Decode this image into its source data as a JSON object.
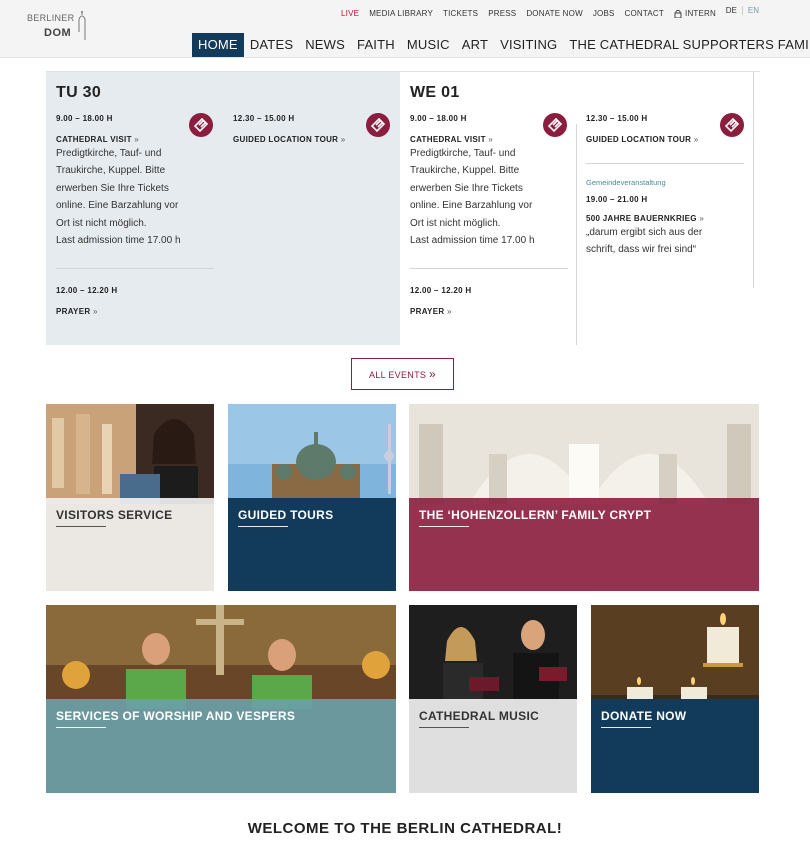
{
  "header": {
    "logo": {
      "line1": "BERLINER",
      "line2": "DOM"
    },
    "top_links": [
      "LIVE",
      "MEDIA LIBRARY",
      "TICKETS",
      "PRESS",
      "DONATE NOW",
      "JOBS",
      "CONTACT"
    ],
    "intern": "INTERN",
    "languages": {
      "de": "DE",
      "en": "EN"
    },
    "main_nav": [
      "HOME",
      "DATES",
      "NEWS",
      "FAITH",
      "MUSIC",
      "ART",
      "VISITING",
      "THE CATHEDRAL SUPPORTERS FAMILY"
    ],
    "active_nav": "HOME"
  },
  "events": {
    "day1": {
      "label": "TU 30",
      "col1": {
        "event1": {
          "time": "9.00 – 18.00 H",
          "title": "CATHEDRAL VISIT",
          "desc": [
            "Predigtkirche, Tauf- und",
            "Traukirche, Kuppel. Bitte",
            "erwerben Sie Ihre Tickets",
            "online. Eine Barzahlung vor",
            "Ort ist nicht möglich.",
            "Last admission time 17.00 h"
          ]
        },
        "event2": {
          "time": "12.00 – 12.20 H",
          "title": "PRAYER"
        }
      },
      "col2": {
        "event1": {
          "time": "12.30 – 15.00 H",
          "title": "GUIDED LOCATION TOUR"
        }
      }
    },
    "day2": {
      "label": "WE 01",
      "col1": {
        "event1": {
          "time": "9.00 – 18.00 H",
          "title": "CATHEDRAL VISIT",
          "desc": [
            "Predigtkirche, Tauf- und",
            "Traukirche, Kuppel. Bitte",
            "erwerben Sie Ihre Tickets",
            "online. Eine Barzahlung vor",
            "Ort ist nicht möglich.",
            "Last admission time 17.00 h"
          ]
        },
        "event2": {
          "time": "12.00 – 12.20 H",
          "title": "PRAYER"
        }
      },
      "col2": {
        "event1": {
          "time": "12.30 – 15.00 H",
          "title": "GUIDED LOCATION TOUR"
        },
        "event2": {
          "category": "Gemeindeveranstaltung",
          "time": "19.00 – 21.00 H",
          "title": "500 JAHRE BAUERNKRIEG",
          "desc": [
            "„darum ergibt sich aus der",
            "schrift, dass wir frei sind“"
          ]
        }
      }
    },
    "all_events": "ALL EVENTS"
  },
  "tiles": [
    {
      "label": "VISITORS SERVICE"
    },
    {
      "label": "GUIDED TOURS"
    },
    {
      "label": "THE ‘HOHENZOLLERN’ FAMILY CRYPT"
    },
    {
      "label": "SERVICES OF WORSHIP AND VESPERS"
    },
    {
      "label": "CATHEDRAL MUSIC"
    },
    {
      "label": "DONATE NOW"
    }
  ],
  "welcome": "WELCOME TO THE BERLIN CATHEDRAL!",
  "colors": {
    "nav_active": "#123a5a",
    "accent": "#8b1e3f",
    "live": "#c8102e",
    "tile_blue": "#123a5a",
    "tile_crimson": "#8b1e3f",
    "tile_teal": "#6a9fa7"
  },
  "icons": [
    "ticket-icon",
    "lock-icon",
    "double-chevron-right-icon"
  ]
}
